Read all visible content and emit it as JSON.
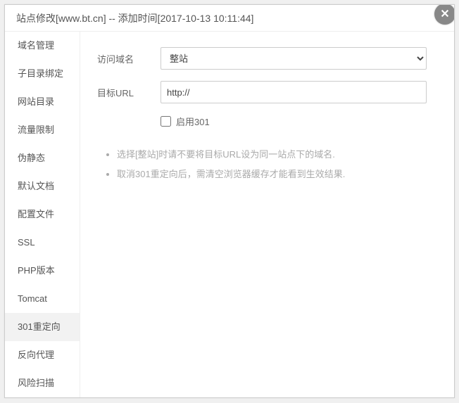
{
  "title": "站点修改[www.bt.cn] -- 添加时间[2017-10-13 10:11:44]",
  "sidebar": {
    "items": [
      {
        "label": "域名管理",
        "active": false
      },
      {
        "label": "子目录绑定",
        "active": false
      },
      {
        "label": "网站目录",
        "active": false
      },
      {
        "label": "流量限制",
        "active": false
      },
      {
        "label": "伪静态",
        "active": false
      },
      {
        "label": "默认文档",
        "active": false
      },
      {
        "label": "配置文件",
        "active": false
      },
      {
        "label": "SSL",
        "active": false
      },
      {
        "label": "PHP版本",
        "active": false
      },
      {
        "label": "Tomcat",
        "active": false
      },
      {
        "label": "301重定向",
        "active": true
      },
      {
        "label": "反向代理",
        "active": false
      },
      {
        "label": "风险扫描",
        "active": false
      }
    ]
  },
  "form": {
    "domain_label": "访问域名",
    "domain_value": "整站",
    "url_label": "目标URL",
    "url_value": "http://",
    "enable301_label": "启用301",
    "enable301_checked": false
  },
  "tips": [
    "选择[整站]时请不要将目标URL设为同一站点下的域名.",
    "取消301重定向后，需清空浏览器缓存才能看到生效结果."
  ]
}
